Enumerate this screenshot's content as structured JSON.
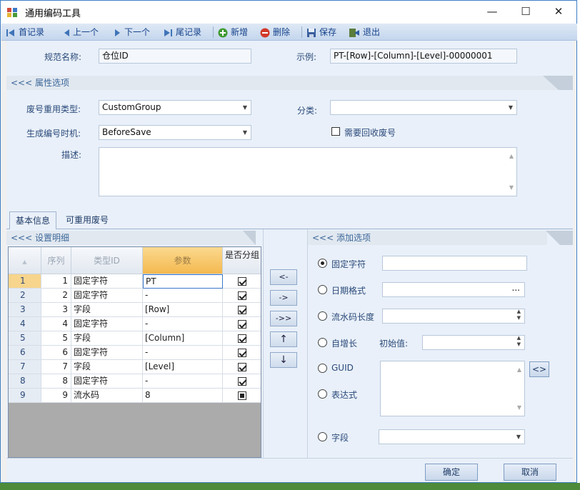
{
  "window": {
    "title": "通用编码工具",
    "minimize": "—",
    "maximize": "☐",
    "close": "✕"
  },
  "toolbar": {
    "first": "首记录",
    "prev": "上一个",
    "next": "下一个",
    "last": "尾记录",
    "add": "新增",
    "delete": "删除",
    "save": "保存",
    "exit": "退出"
  },
  "header": {
    "name_label": "规范名称:",
    "name_value": "仓位ID",
    "example_label": "示例:",
    "example_value": "PT-[Row]-[Column]-[Level]-00000001"
  },
  "props": {
    "section_title": "<<< 属性选项",
    "reuse_label": "废号重用类型:",
    "reuse_value": "CustomGroup",
    "category_label": "分类:",
    "category_value": "",
    "gen_label": "生成编号时机:",
    "gen_value": "BeforeSave",
    "recycle_label": "需要回收废号",
    "recycle_checked": false,
    "desc_label": "描述:",
    "desc_value": ""
  },
  "tabs": [
    {
      "label": "基本信息",
      "active": true
    },
    {
      "label": "可重用废号",
      "active": false
    }
  ],
  "detail": {
    "section_title": "<<< 设置明细",
    "columns": [
      "序列",
      "类型ID",
      "参数",
      "是否分组"
    ],
    "rows": [
      {
        "row": "1",
        "seq": "1",
        "type": "固定字符",
        "param": "PT",
        "group": "checked"
      },
      {
        "row": "2",
        "seq": "2",
        "type": "固定字符",
        "param": "-",
        "group": "checked"
      },
      {
        "row": "3",
        "seq": "3",
        "type": "字段",
        "param": "[Row]",
        "group": "checked"
      },
      {
        "row": "4",
        "seq": "4",
        "type": "固定字符",
        "param": "-",
        "group": "checked"
      },
      {
        "row": "5",
        "seq": "5",
        "type": "字段",
        "param": "[Column]",
        "group": "checked"
      },
      {
        "row": "6",
        "seq": "6",
        "type": "固定字符",
        "param": "-",
        "group": "checked"
      },
      {
        "row": "7",
        "seq": "7",
        "type": "字段",
        "param": "[Level]",
        "group": "checked"
      },
      {
        "row": "8",
        "seq": "8",
        "type": "固定字符",
        "param": "-",
        "group": "checked"
      },
      {
        "row": "9",
        "seq": "9",
        "type": "流水码",
        "param": "8",
        "group": "indeterminate"
      }
    ]
  },
  "move_buttons": {
    "add_one": "<-",
    "remove_one": "->",
    "remove_all": "->>",
    "up": "↑",
    "down": "↓"
  },
  "options": {
    "section_title": "<<< 添加选项",
    "fixed_label": "固定字符",
    "date_label": "日期格式",
    "date_button": "...",
    "serial_label": "流水码长度",
    "auto_label": "自增长",
    "initial_label": "初始值:",
    "guid_label": "GUID",
    "expr_label": "表达式",
    "expr_button": "<>",
    "field_label": "字段",
    "selected": "fixed"
  },
  "footer": {
    "ok": "确定",
    "cancel": "取消"
  },
  "colors": {
    "accent": "#15428b",
    "grid_selected": "#f4b94f",
    "panel": "#e9f0f9"
  }
}
